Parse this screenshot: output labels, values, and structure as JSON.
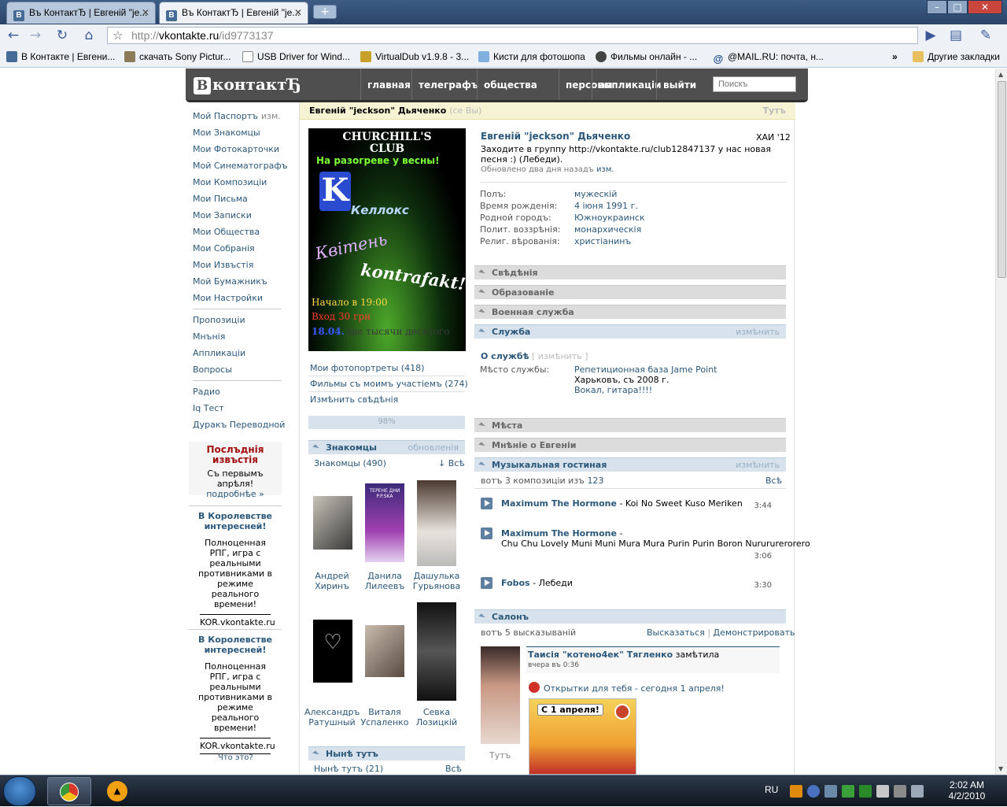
{
  "browser": {
    "tabs": [
      {
        "title": "Въ КонтактЂ | Евгенiй \"je..."
      },
      {
        "title": "Въ КонтактЂ | Евгенiй \"je..."
      }
    ],
    "url_prefix": "http://",
    "url_host": "vkontakte.ru",
    "url_path": "/id9773137",
    "bookmarks": [
      "В Контакте | Евгени...",
      "скачать Sony Pictur...",
      "USB Driver for Wind...",
      "VirtualDub v1.9.8 - 3...",
      "Кисти для фотошопа",
      "Фильмы онлайн - ...",
      "@MAIL.RU: почта, н..."
    ],
    "bookmarks_more": "»",
    "other_bookmarks": "Другие закладки"
  },
  "vk": {
    "logo": "контактЂ",
    "logo_letter": "В",
    "nav": [
      "главная",
      "телеграфъ",
      "общества",
      "персоны",
      "аппликацiи",
      "выйти"
    ],
    "search_placeholder": "Поискъ"
  },
  "leftnav": {
    "group1": [
      "Мой Паспортъ",
      "Мои Знакомцы",
      "Мои Фотокарточки",
      "Мой Синематографъ",
      "Мои Композицiи",
      "Мои Письма",
      "Мои Записки",
      "Мои Общества",
      "Мои Собранiя",
      "Мои Извъстiя",
      "Мой Бумажникъ",
      "Мои Настройки"
    ],
    "edit_label": "изм.",
    "group2": [
      "Пропозицiи",
      "Мнънiя",
      "Аппликацiи",
      "Вопросы"
    ],
    "group3": [
      "Радио",
      "Iq Тест",
      "Дуракъ Переводной"
    ],
    "news_title": "Послъднiя извъстiя",
    "news_text": "Съ первымъ апрѣля!",
    "news_more": "подробнѣе »",
    "ad1_title": "В Королевстве интересней!",
    "ad1_text": "Полноценная РПГ, игра с реальными противниками в режиме реального времени!",
    "ad1_url": "KOR.vkontakte.ru",
    "ad2_title": "В Королевстве интересней!",
    "ad2_text": "Полноценная РПГ, игра с реальными противниками в режиме реального времени!",
    "ad2_url": "KOR.vkontakte.ru",
    "whats_this": "Что это?"
  },
  "profile": {
    "header_name": "Евгенiй \"jeckson\" Дьяченко",
    "header_you": "(сe Вы)",
    "header_right": "Тутъ",
    "name": "Евгенiй \"jeckson\" Дьяченко",
    "university": "ХАИ '12",
    "status": "Заходите в группу http://vkontakte.ru/club12847137 у нас новая песня :) (Лебеди).",
    "updated": "Обновлено два дня назадъ",
    "updated_edit": "изм.",
    "info": [
      {
        "label": "Полъ:",
        "value": "мужескiй"
      },
      {
        "label": "Время рожденiя:",
        "value": "4 iюня 1991 г."
      },
      {
        "label": "Родной городъ:",
        "value": "Южноукраинск"
      },
      {
        "label": "Полит. воззрѣнiя:",
        "value": "монархическiя"
      },
      {
        "label": "Религ. вѣрованiя:",
        "value": "христiанинъ"
      }
    ],
    "poster": {
      "line1": "CHURCHILL'S",
      "line2": "CLUB",
      "line3": "На разогреве у весны!",
      "band1": "Келлокс",
      "band2": "Квiтень",
      "band3": "kontrafakt!",
      "start": "Начало в 19:00",
      "entry": "Вход 30 грн",
      "date": "18.04.",
      "date_note": "две тысячи десятого"
    },
    "photo_links": [
      "Мои фотопортреты (418)",
      "Фильмы съ моимъ участiемъ (274)",
      "Измѣнить свѣдѣнiя"
    ],
    "completion": "98%",
    "friends_title": "Знакомцы",
    "friends_action": "обновленiя",
    "friends_count": "Знакомцы (490)",
    "friends_all": "↓ Всѣ",
    "friends": [
      {
        "first": "Андрей",
        "last": "Хиринъ"
      },
      {
        "first": "Данила",
        "last": "Лилеевъ"
      },
      {
        "first": "Дашулька",
        "last": "Гурьянова"
      },
      {
        "first": "Александръ",
        "last": "Ратушный"
      },
      {
        "first": "Виталя",
        "last": "Успаленко"
      },
      {
        "first": "Севка",
        "last": "Лозицкiй"
      }
    ],
    "friend_tag": "ТЕРЕНЕ ДНИ P.P.SKA",
    "online_title": "Нынѣ тутъ",
    "online_count": "Нынѣ тутъ (21)",
    "online_all": "Всѣ",
    "sections": {
      "s1": "Свѣдѣнiя",
      "s2": "Образованiе",
      "s3": "Военная служба",
      "s4": "Служба",
      "s4_action": "измѣнить",
      "s5": "Мѣста",
      "s6": "Мнѣнiе о Евгенiи",
      "s7": "Музыкальная гостиная",
      "s7_action": "измѣнить",
      "s8": "Салонъ"
    },
    "service": {
      "title": "О службѣ",
      "edit": "[ измѣнить ]",
      "label": "Мѣсто службы:",
      "place": "Репетиционная база Jame Point",
      "city": "Харьковъ, съ 2008 г.",
      "role": "Вокал, гитара!!!!"
    },
    "music": {
      "summary": "вотъ 3 композицiи изъ",
      "total": "123",
      "all": "Всѣ",
      "tracks": [
        {
          "artist": "Maximum The Hormone",
          "title": " - Koi No Sweet Kuso Meriken",
          "duration": "3:44"
        },
        {
          "artist": "Maximum The Hormone",
          "title": " - ",
          "title2": "Chu Chu Lovely Muni Muni Mura Mura Purin Purin Boron Nurururerorero",
          "duration": "3:06"
        },
        {
          "artist": "Fobos",
          "title": " - Лебеди",
          "duration": "3:30"
        }
      ]
    },
    "wall": {
      "summary": "вотъ 5 высказыванiй",
      "say": "Высказаться",
      "show": "Демонстрировать",
      "author": "Таисiя \"котено4ек\" Тягленко",
      "author_action": "замѣтила",
      "time": "вчера въ 0:36",
      "app_text": "Открытки для тебя - сегодня 1 апреля!",
      "card_text": "С 1 апреля!",
      "author_caption": "Тутъ"
    }
  },
  "taskbar": {
    "lang": "RU",
    "time": "2:02 AM",
    "date": "4/2/2010"
  }
}
